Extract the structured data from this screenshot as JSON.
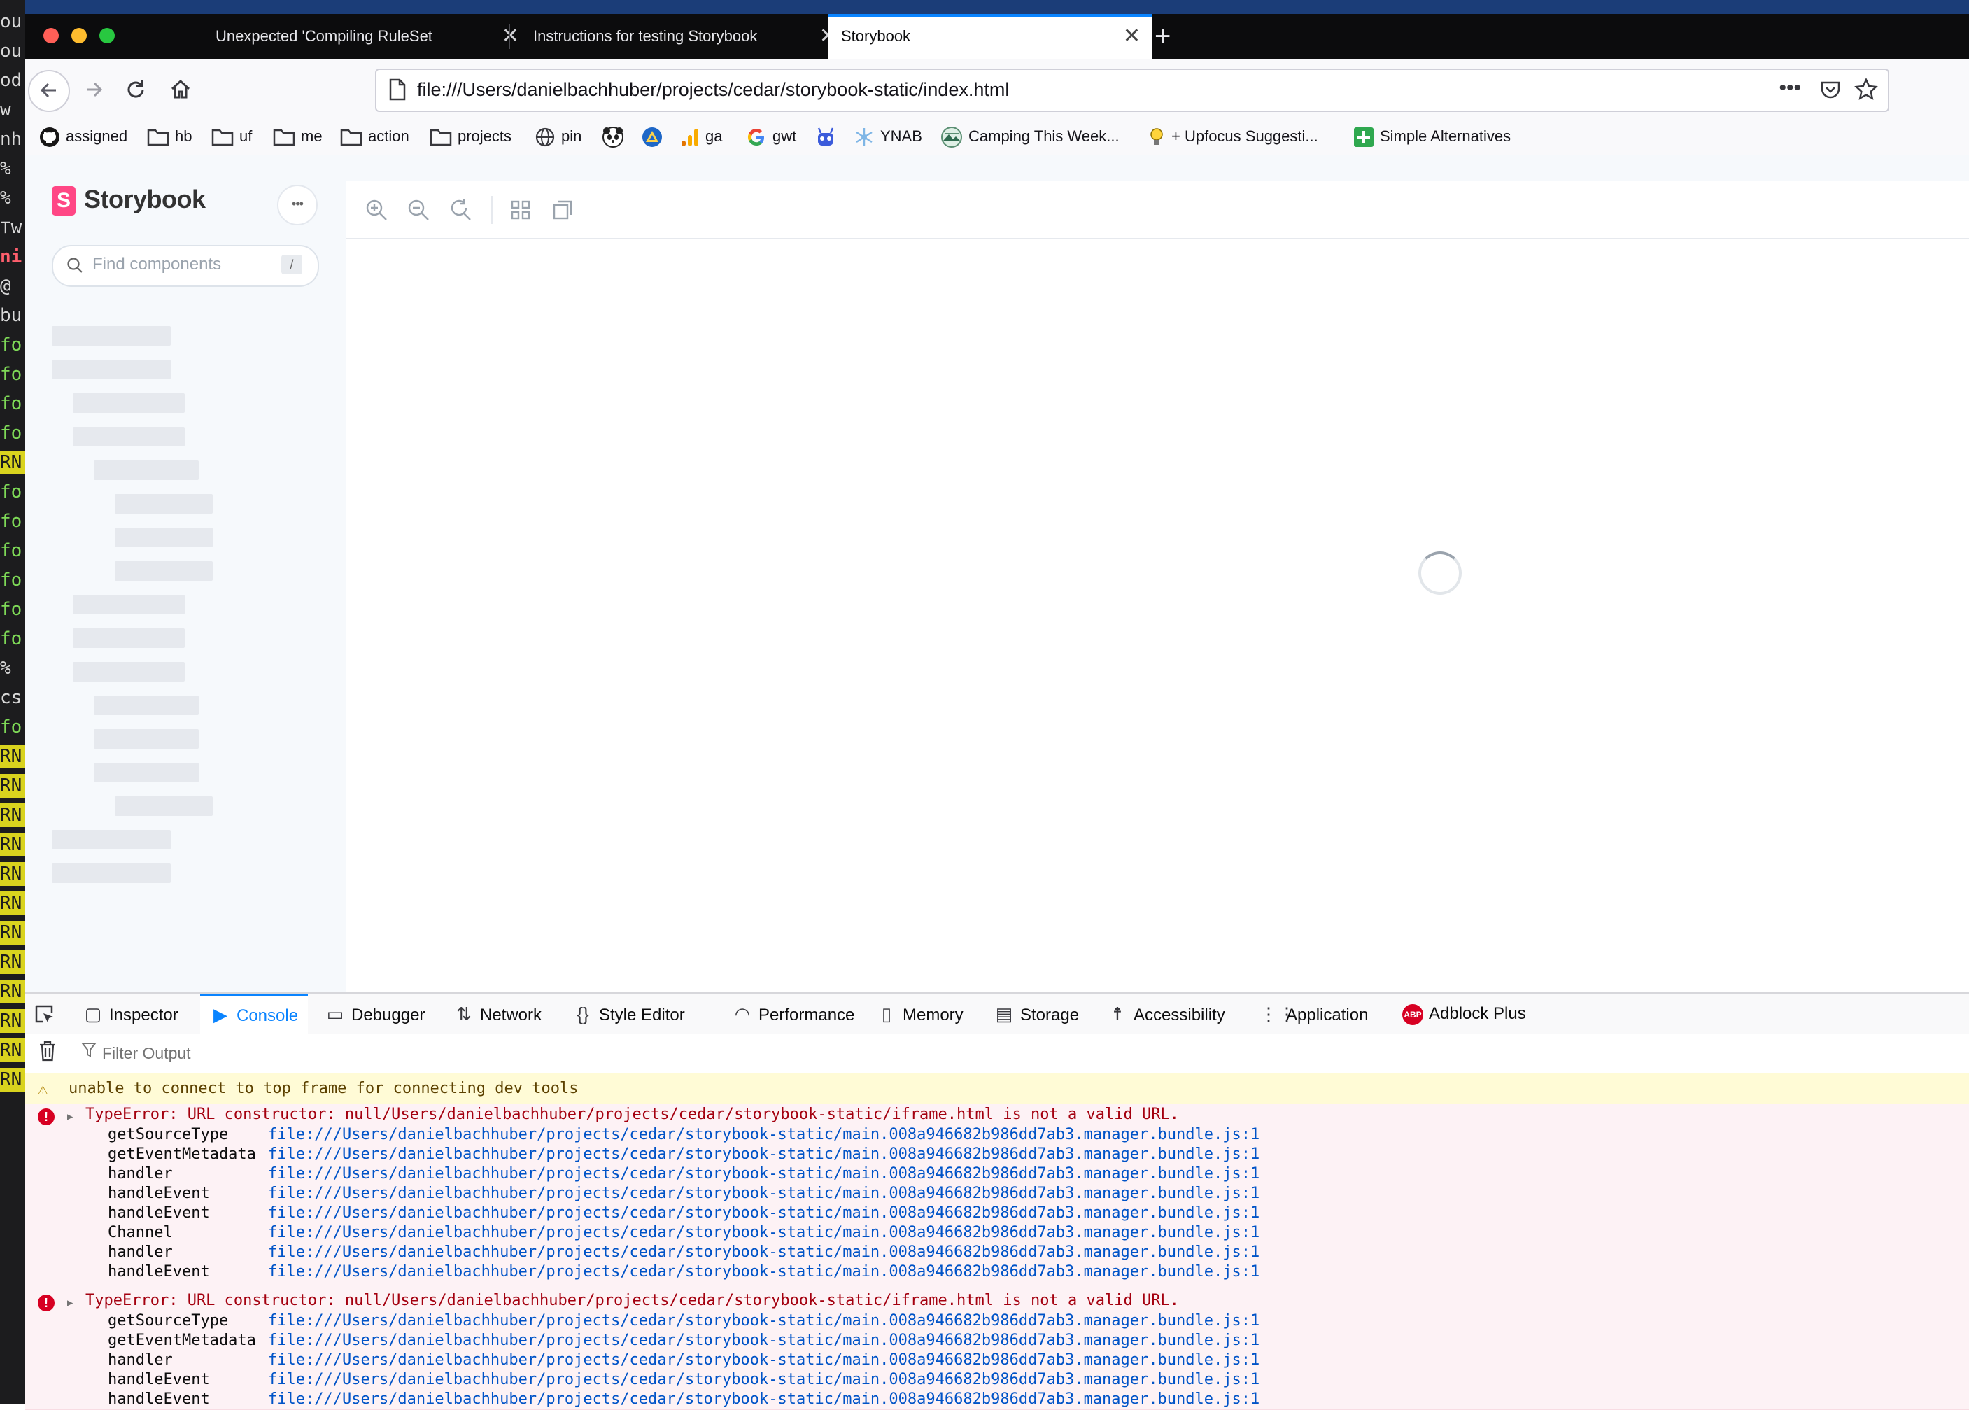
{
  "browser": {
    "tabs": [
      {
        "label": "Unexpected 'Compiling RuleSet",
        "active": false
      },
      {
        "label": "Instructions for testing Storybook",
        "active": false
      },
      {
        "label": "Storybook",
        "active": true
      }
    ],
    "new_tab_glyph": "+",
    "close_glyph": "✕",
    "url": "file:///Users/danielbachhuber/projects/cedar/storybook-static/index.html",
    "bookmarks": [
      {
        "label": "assigned",
        "icon": "github-icon"
      },
      {
        "label": "hb",
        "icon": "folder-icon"
      },
      {
        "label": "uf",
        "icon": "folder-icon"
      },
      {
        "label": "me",
        "icon": "folder-icon"
      },
      {
        "label": "action",
        "icon": "folder-icon"
      },
      {
        "label": "projects",
        "icon": "folder-icon"
      },
      {
        "label": "pin",
        "icon": "globe-icon"
      },
      {
        "label": "",
        "icon": "panda-icon"
      },
      {
        "label": "",
        "icon": "triangle-icon"
      },
      {
        "label": "ga",
        "icon": "analytics-icon"
      },
      {
        "label": "gwt",
        "icon": "google-icon"
      },
      {
        "label": "",
        "icon": "robot-icon"
      },
      {
        "label": "YNAB",
        "icon": "ynab-icon"
      },
      {
        "label": "Camping This Week...",
        "icon": "camping-icon"
      },
      {
        "label": "+ Upfocus Suggesti...",
        "icon": "lightbulb-icon"
      },
      {
        "label": "Simple Alternatives",
        "icon": "plus-square-icon"
      }
    ]
  },
  "storybook": {
    "brand": "Storybook",
    "logo_letter": "S",
    "menu_glyph": "•••",
    "search_placeholder": "Find components",
    "search_shortcut": "/"
  },
  "devtools": {
    "tabs": [
      {
        "label": "Inspector",
        "icon": "inspector-icon",
        "active": false
      },
      {
        "label": "Console",
        "icon": "console-icon",
        "active": true
      },
      {
        "label": "Debugger",
        "icon": "debugger-icon",
        "active": false
      },
      {
        "label": "Network",
        "icon": "network-icon",
        "active": false
      },
      {
        "label": "Style Editor",
        "icon": "style-editor-icon",
        "active": false
      },
      {
        "label": "Performance",
        "icon": "performance-icon",
        "active": false
      },
      {
        "label": "Memory",
        "icon": "memory-icon",
        "active": false
      },
      {
        "label": "Storage",
        "icon": "storage-icon",
        "active": false
      },
      {
        "label": "Accessibility",
        "icon": "accessibility-icon",
        "active": false
      },
      {
        "label": "Application",
        "icon": "application-icon",
        "active": false
      },
      {
        "label": "Adblock Plus",
        "icon": "adblock-icon",
        "active": false
      }
    ],
    "filter_placeholder": "Filter Output",
    "warning": "unable to connect to top frame for connecting dev tools",
    "errors": [
      {
        "message": "TypeError: URL constructor: null/Users/danielbachhuber/projects/cedar/storybook-static/iframe.html is not a valid URL.",
        "frames": [
          {
            "fn": "getSourceType",
            "src": "file:///Users/danielbachhuber/projects/cedar/storybook-static/main.008a946682b986dd7ab3.manager.bundle.js:1"
          },
          {
            "fn": "getEventMetadata",
            "src": "file:///Users/danielbachhuber/projects/cedar/storybook-static/main.008a946682b986dd7ab3.manager.bundle.js:1"
          },
          {
            "fn": "handler",
            "src": "file:///Users/danielbachhuber/projects/cedar/storybook-static/main.008a946682b986dd7ab3.manager.bundle.js:1"
          },
          {
            "fn": "handleEvent",
            "src": "file:///Users/danielbachhuber/projects/cedar/storybook-static/main.008a946682b986dd7ab3.manager.bundle.js:1"
          },
          {
            "fn": "handleEvent",
            "src": "file:///Users/danielbachhuber/projects/cedar/storybook-static/main.008a946682b986dd7ab3.manager.bundle.js:1"
          },
          {
            "fn": "Channel",
            "src": "file:///Users/danielbachhuber/projects/cedar/storybook-static/main.008a946682b986dd7ab3.manager.bundle.js:1"
          },
          {
            "fn": "handler",
            "src": "file:///Users/danielbachhuber/projects/cedar/storybook-static/main.008a946682b986dd7ab3.manager.bundle.js:1"
          },
          {
            "fn": "handleEvent",
            "src": "file:///Users/danielbachhuber/projects/cedar/storybook-static/main.008a946682b986dd7ab3.manager.bundle.js:1"
          }
        ]
      },
      {
        "message": "TypeError: URL constructor: null/Users/danielbachhuber/projects/cedar/storybook-static/iframe.html is not a valid URL.",
        "frames": [
          {
            "fn": "getSourceType",
            "src": "file:///Users/danielbachhuber/projects/cedar/storybook-static/main.008a946682b986dd7ab3.manager.bundle.js:1"
          },
          {
            "fn": "getEventMetadata",
            "src": "file:///Users/danielbachhuber/projects/cedar/storybook-static/main.008a946682b986dd7ab3.manager.bundle.js:1"
          },
          {
            "fn": "handler",
            "src": "file:///Users/danielbachhuber/projects/cedar/storybook-static/main.008a946682b986dd7ab3.manager.bundle.js:1"
          },
          {
            "fn": "handleEvent",
            "src": "file:///Users/danielbachhuber/projects/cedar/storybook-static/main.008a946682b986dd7ab3.manager.bundle.js:1"
          },
          {
            "fn": "handleEvent",
            "src": "file:///Users/danielbachhuber/projects/cedar/storybook-static/main.008a946682b986dd7ab3.manager.bundle.js:1"
          }
        ]
      }
    ]
  },
  "terminal": {
    "lines": [
      {
        "text": "ou",
        "style": ""
      },
      {
        "text": "ou",
        "style": ""
      },
      {
        "text": "od",
        "style": ""
      },
      {
        "text": " w",
        "style": ""
      },
      {
        "text": "nh",
        "style": ""
      },
      {
        "text": "%",
        "style": ""
      },
      {
        "text": "%",
        "style": ""
      },
      {
        "text": "⊤w",
        "style": ""
      },
      {
        "text": "ni",
        "style": "red"
      },
      {
        "text": "@",
        "style": ""
      },
      {
        "text": "bu",
        "style": ""
      },
      {
        "text": "fo",
        "style": "green"
      },
      {
        "text": "fo",
        "style": "green"
      },
      {
        "text": "fo",
        "style": "green"
      },
      {
        "text": "fo",
        "style": "green"
      },
      {
        "text": "RN",
        "style": "warn"
      },
      {
        "text": "fo",
        "style": "green"
      },
      {
        "text": "fo",
        "style": "green"
      },
      {
        "text": "fo",
        "style": "green"
      },
      {
        "text": "fo",
        "style": "green"
      },
      {
        "text": "fo",
        "style": "green"
      },
      {
        "text": "fo",
        "style": "green"
      },
      {
        "text": "%",
        "style": ""
      },
      {
        "text": "cs",
        "style": ""
      },
      {
        "text": "fo",
        "style": "green"
      },
      {
        "text": "RN",
        "style": "warn"
      },
      {
        "text": "RN",
        "style": "warn"
      },
      {
        "text": "RN",
        "style": "warn"
      },
      {
        "text": "RN",
        "style": "warn"
      },
      {
        "text": "RN",
        "style": "warn"
      },
      {
        "text": "RN",
        "style": "warn"
      },
      {
        "text": "RN",
        "style": "warn"
      },
      {
        "text": "RN",
        "style": "warn"
      },
      {
        "text": "RN",
        "style": "warn"
      },
      {
        "text": "RN",
        "style": "warn"
      },
      {
        "text": "RN",
        "style": "warn"
      },
      {
        "text": "RN",
        "style": "warn"
      }
    ]
  },
  "colors": {
    "storybook_pink": "#ff4785",
    "firefox_blue": "#0a84ff",
    "error_red": "#d70022",
    "warning_bg": "#fffbd6",
    "terminal_warn": "#d9d31e"
  }
}
